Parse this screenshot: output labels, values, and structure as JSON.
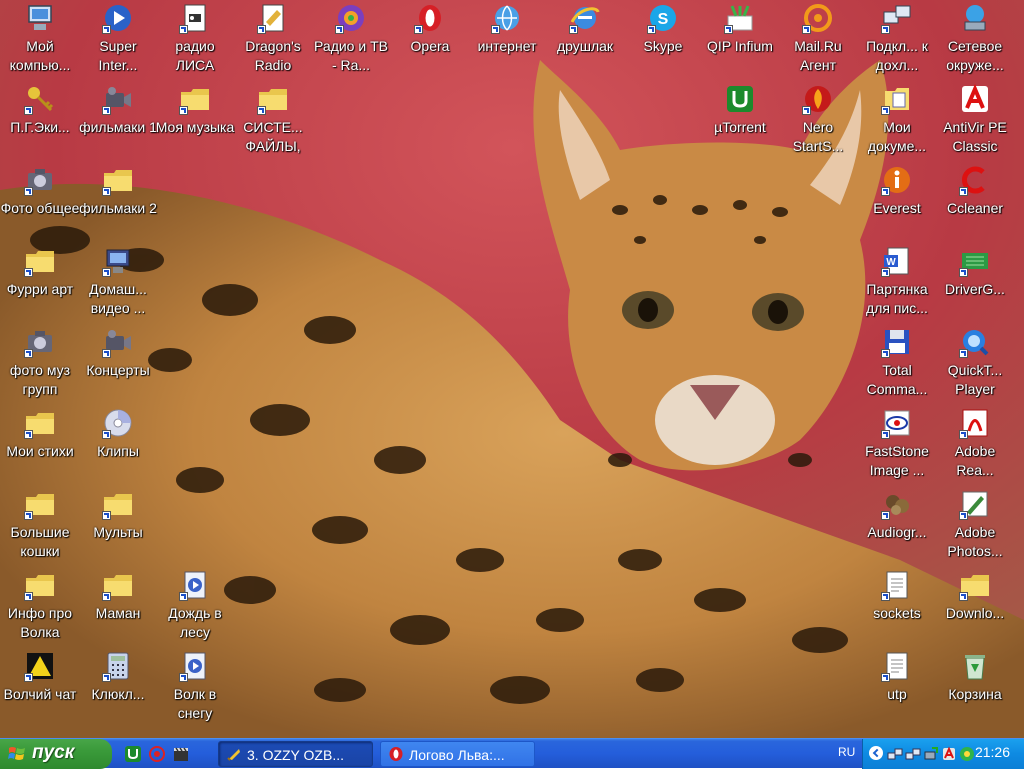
{
  "desktop": {
    "icons": [
      {
        "label": "Мой компью...",
        "icon": "my-computer-icon",
        "shortcut": false
      },
      {
        "label": "Super Inter...",
        "icon": "media-player-icon",
        "shortcut": true
      },
      {
        "label": "радио ЛИСА",
        "icon": "radio-document-icon",
        "shortcut": true
      },
      {
        "label": "Dragon's Radio",
        "icon": "dragon-radio-icon",
        "shortcut": true
      },
      {
        "label": "Радио и ТВ - Ra...",
        "icon": "radio-tv-icon",
        "shortcut": true
      },
      {
        "label": "Opera",
        "icon": "opera-icon",
        "shortcut": true
      },
      {
        "label": "интернет",
        "icon": "internet-icon",
        "shortcut": true
      },
      {
        "label": "друшлак",
        "icon": "internet-explorer-icon",
        "shortcut": true
      },
      {
        "label": "Skype",
        "icon": "skype-icon",
        "shortcut": true
      },
      {
        "label": "QIP Infium",
        "icon": "qip-icon",
        "shortcut": true
      },
      {
        "label": "Mail.Ru Агент",
        "icon": "mailru-agent-icon",
        "shortcut": true
      },
      {
        "label": "Подкл... к дохл...",
        "icon": "network-connect-icon",
        "shortcut": true
      },
      {
        "label": "Сетевое окруже...",
        "icon": "network-places-icon",
        "shortcut": false
      },
      {
        "label": "П.Г.Эки...",
        "icon": "keys-icon",
        "shortcut": true
      },
      {
        "label": "фильмаки 1",
        "icon": "video-camera-icon",
        "shortcut": true
      },
      {
        "label": "Моя музыка",
        "icon": "folder-icon",
        "shortcut": true
      },
      {
        "label": "СИСТЕ... ФАЙЛЫ,",
        "icon": "folder-icon",
        "shortcut": true
      },
      {
        "label": "µTorrent",
        "icon": "utorrent-icon",
        "shortcut": false
      },
      {
        "label": "Nero StartS...",
        "icon": "nero-icon",
        "shortcut": true
      },
      {
        "label": "Мои докуме...",
        "icon": "my-documents-icon",
        "shortcut": true
      },
      {
        "label": "AntiVir PE Classic",
        "icon": "antivir-icon",
        "shortcut": false
      },
      {
        "label": "Фото общее",
        "icon": "camera-icon",
        "shortcut": true
      },
      {
        "label": "фильмаки 2",
        "icon": "folder-icon",
        "shortcut": true
      },
      {
        "label": "Everest",
        "icon": "everest-icon",
        "shortcut": true
      },
      {
        "label": "Ccleaner",
        "icon": "ccleaner-icon",
        "shortcut": true
      },
      {
        "label": "Фурри арт",
        "icon": "folder-icon",
        "shortcut": true
      },
      {
        "label": "Домаш... видео ...",
        "icon": "home-video-icon",
        "shortcut": true
      },
      {
        "label": "Партянка для пис...",
        "icon": "word-document-icon",
        "shortcut": true
      },
      {
        "label": "DriverG...",
        "icon": "driver-genius-icon",
        "shortcut": true
      },
      {
        "label": "фото муз групп",
        "icon": "camera-icon",
        "shortcut": true
      },
      {
        "label": "Концерты",
        "icon": "video-camera-icon",
        "shortcut": true
      },
      {
        "label": "Total Comma...",
        "icon": "floppy-disk-icon",
        "shortcut": true
      },
      {
        "label": "QuickT... Player",
        "icon": "quicktime-icon",
        "shortcut": true
      },
      {
        "label": "Мои стихи",
        "icon": "folder-icon",
        "shortcut": true
      },
      {
        "label": "Клипы",
        "icon": "cd-disc-icon",
        "shortcut": true
      },
      {
        "label": "FastStone Image ...",
        "icon": "faststone-icon",
        "shortcut": true
      },
      {
        "label": "Adobe Rea...",
        "icon": "adobe-reader-icon",
        "shortcut": true
      },
      {
        "label": "Большие кошки",
        "icon": "folder-icon",
        "shortcut": true
      },
      {
        "label": "Мульты",
        "icon": "folder-icon",
        "shortcut": true
      },
      {
        "label": "Audiogr...",
        "icon": "audiograbber-icon",
        "shortcut": true
      },
      {
        "label": "Adobe Photos...",
        "icon": "photoshop-icon",
        "shortcut": true
      },
      {
        "label": "Инфо про Волка",
        "icon": "folder-icon",
        "shortcut": true
      },
      {
        "label": "Маман",
        "icon": "folder-icon",
        "shortcut": true
      },
      {
        "label": "Дождь в лесу",
        "icon": "media-file-icon",
        "shortcut": true
      },
      {
        "label": "sockets",
        "icon": "text-file-icon",
        "shortcut": true
      },
      {
        "label": "Downlo...",
        "icon": "folder-icon",
        "shortcut": true
      },
      {
        "label": "Волчий чат",
        "icon": "wolf-chat-icon",
        "shortcut": true
      },
      {
        "label": "Клюкл...",
        "icon": "calculator-icon",
        "shortcut": true
      },
      {
        "label": "Волк в снегу",
        "icon": "media-file-icon",
        "shortcut": true
      },
      {
        "label": "utp",
        "icon": "text-file-icon",
        "shortcut": true
      },
      {
        "label": "Корзина",
        "icon": "recycle-bin-icon",
        "shortcut": false
      }
    ]
  },
  "taskbar": {
    "start_label": "пуск",
    "quick_launch": [
      {
        "icon": "utorrent-icon"
      },
      {
        "icon": "opera-target-icon"
      },
      {
        "icon": "movie-clapper-icon"
      }
    ],
    "quick_launch_more": "»",
    "tasks": [
      {
        "label": "3. OZZY OZB...",
        "icon": "winamp-icon",
        "active": true
      },
      {
        "label": "Логово Льва:...",
        "icon": "opera-icon",
        "active": false
      }
    ],
    "language": "RU",
    "tray_icons": [
      "network-icon",
      "network-icon",
      "safely-remove-icon",
      "antivir-tray-icon",
      "icq-flower-icon"
    ],
    "clock": "21:26"
  },
  "colors": {
    "taskbar_blue": "#245edb",
    "start_green": "#3a9a3a",
    "tray_blue": "#0e8ae2"
  }
}
